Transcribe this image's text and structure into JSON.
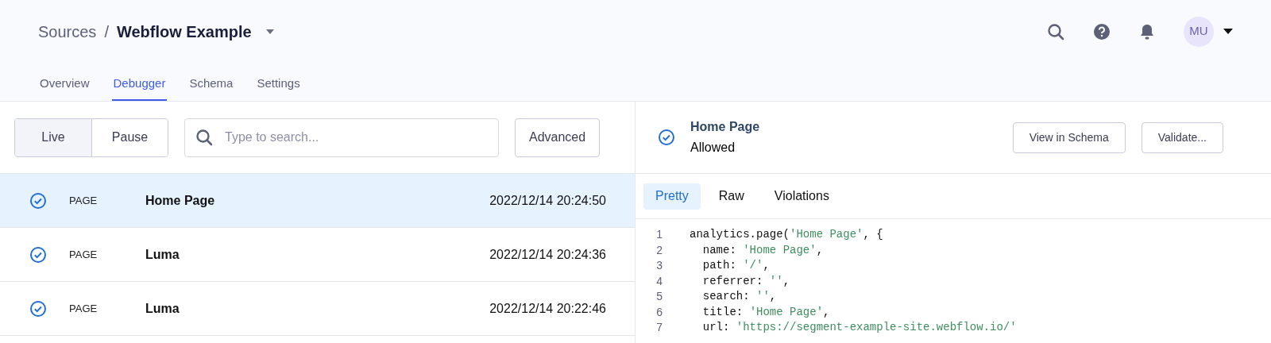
{
  "breadcrumb": {
    "parent": "Sources",
    "separator": "/",
    "current": "Webflow Example"
  },
  "user": {
    "initials": "MU"
  },
  "nav_tabs": [
    {
      "label": "Overview",
      "selected": false
    },
    {
      "label": "Debugger",
      "selected": true
    },
    {
      "label": "Schema",
      "selected": false
    },
    {
      "label": "Settings",
      "selected": false
    }
  ],
  "mode_toggle": [
    {
      "label": "Live",
      "selected": true
    },
    {
      "label": "Pause",
      "selected": false
    }
  ],
  "search": {
    "placeholder": "Type to search..."
  },
  "advanced_button": "Advanced",
  "events": [
    {
      "type": "PAGE",
      "name": "Home Page",
      "time": "2022/12/14 20:24:50",
      "selected": true
    },
    {
      "type": "PAGE",
      "name": "Luma",
      "time": "2022/12/14 20:24:36",
      "selected": false
    },
    {
      "type": "PAGE",
      "name": "Luma",
      "time": "2022/12/14 20:22:46",
      "selected": false
    }
  ],
  "detail": {
    "title": "Home Page",
    "status": "Allowed",
    "buttons": [
      "View in Schema",
      "Validate..."
    ],
    "tabs": [
      {
        "label": "Pretty",
        "selected": true
      },
      {
        "label": "Raw",
        "selected": false
      },
      {
        "label": "Violations",
        "selected": false
      }
    ],
    "code": [
      {
        "number": "1",
        "parts": [
          {
            "kind": "plain",
            "text": "analytics.page("
          },
          {
            "kind": "string",
            "text": "'Home Page'"
          },
          {
            "kind": "plain",
            "text": ", {"
          }
        ]
      },
      {
        "number": "2",
        "parts": [
          {
            "kind": "plain",
            "text": "  name: "
          },
          {
            "kind": "string",
            "text": "'Home Page'"
          },
          {
            "kind": "plain",
            "text": ","
          }
        ]
      },
      {
        "number": "3",
        "parts": [
          {
            "kind": "plain",
            "text": "  path: "
          },
          {
            "kind": "string",
            "text": "'/'"
          },
          {
            "kind": "plain",
            "text": ","
          }
        ]
      },
      {
        "number": "4",
        "parts": [
          {
            "kind": "plain",
            "text": "  referrer: "
          },
          {
            "kind": "string",
            "text": "''"
          },
          {
            "kind": "plain",
            "text": ","
          }
        ]
      },
      {
        "number": "5",
        "parts": [
          {
            "kind": "plain",
            "text": "  search: "
          },
          {
            "kind": "string",
            "text": "''"
          },
          {
            "kind": "plain",
            "text": ","
          }
        ]
      },
      {
        "number": "6",
        "parts": [
          {
            "kind": "plain",
            "text": "  title: "
          },
          {
            "kind": "string",
            "text": "'Home Page'"
          },
          {
            "kind": "plain",
            "text": ","
          }
        ]
      },
      {
        "number": "7",
        "parts": [
          {
            "kind": "plain",
            "text": "  url: "
          },
          {
            "kind": "string",
            "text": "'https://segment-example-site.webflow.io/'"
          }
        ]
      }
    ]
  }
}
